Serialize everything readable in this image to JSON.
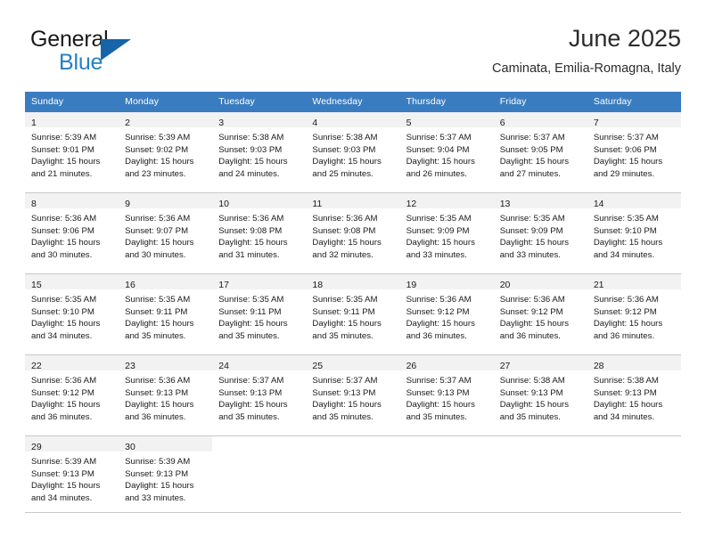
{
  "brand": {
    "word1": "General",
    "word2": "Blue",
    "triangle_color": "#1565a8",
    "blue_color": "#2481c4"
  },
  "header": {
    "title": "June 2025",
    "subtitle": "Caminata, Emilia-Romagna, Italy",
    "header_bg": "#3a7cc0"
  },
  "weekdays": [
    "Sunday",
    "Monday",
    "Tuesday",
    "Wednesday",
    "Thursday",
    "Friday",
    "Saturday"
  ],
  "weeks": [
    [
      {
        "day": "1",
        "sunrise": "Sunrise: 5:39 AM",
        "sunset": "Sunset: 9:01 PM",
        "daylight1": "Daylight: 15 hours",
        "daylight2": "and 21 minutes."
      },
      {
        "day": "2",
        "sunrise": "Sunrise: 5:39 AM",
        "sunset": "Sunset: 9:02 PM",
        "daylight1": "Daylight: 15 hours",
        "daylight2": "and 23 minutes."
      },
      {
        "day": "3",
        "sunrise": "Sunrise: 5:38 AM",
        "sunset": "Sunset: 9:03 PM",
        "daylight1": "Daylight: 15 hours",
        "daylight2": "and 24 minutes."
      },
      {
        "day": "4",
        "sunrise": "Sunrise: 5:38 AM",
        "sunset": "Sunset: 9:03 PM",
        "daylight1": "Daylight: 15 hours",
        "daylight2": "and 25 minutes."
      },
      {
        "day": "5",
        "sunrise": "Sunrise: 5:37 AM",
        "sunset": "Sunset: 9:04 PM",
        "daylight1": "Daylight: 15 hours",
        "daylight2": "and 26 minutes."
      },
      {
        "day": "6",
        "sunrise": "Sunrise: 5:37 AM",
        "sunset": "Sunset: 9:05 PM",
        "daylight1": "Daylight: 15 hours",
        "daylight2": "and 27 minutes."
      },
      {
        "day": "7",
        "sunrise": "Sunrise: 5:37 AM",
        "sunset": "Sunset: 9:06 PM",
        "daylight1": "Daylight: 15 hours",
        "daylight2": "and 29 minutes."
      }
    ],
    [
      {
        "day": "8",
        "sunrise": "Sunrise: 5:36 AM",
        "sunset": "Sunset: 9:06 PM",
        "daylight1": "Daylight: 15 hours",
        "daylight2": "and 30 minutes."
      },
      {
        "day": "9",
        "sunrise": "Sunrise: 5:36 AM",
        "sunset": "Sunset: 9:07 PM",
        "daylight1": "Daylight: 15 hours",
        "daylight2": "and 30 minutes."
      },
      {
        "day": "10",
        "sunrise": "Sunrise: 5:36 AM",
        "sunset": "Sunset: 9:08 PM",
        "daylight1": "Daylight: 15 hours",
        "daylight2": "and 31 minutes."
      },
      {
        "day": "11",
        "sunrise": "Sunrise: 5:36 AM",
        "sunset": "Sunset: 9:08 PM",
        "daylight1": "Daylight: 15 hours",
        "daylight2": "and 32 minutes."
      },
      {
        "day": "12",
        "sunrise": "Sunrise: 5:35 AM",
        "sunset": "Sunset: 9:09 PM",
        "daylight1": "Daylight: 15 hours",
        "daylight2": "and 33 minutes."
      },
      {
        "day": "13",
        "sunrise": "Sunrise: 5:35 AM",
        "sunset": "Sunset: 9:09 PM",
        "daylight1": "Daylight: 15 hours",
        "daylight2": "and 33 minutes."
      },
      {
        "day": "14",
        "sunrise": "Sunrise: 5:35 AM",
        "sunset": "Sunset: 9:10 PM",
        "daylight1": "Daylight: 15 hours",
        "daylight2": "and 34 minutes."
      }
    ],
    [
      {
        "day": "15",
        "sunrise": "Sunrise: 5:35 AM",
        "sunset": "Sunset: 9:10 PM",
        "daylight1": "Daylight: 15 hours",
        "daylight2": "and 34 minutes."
      },
      {
        "day": "16",
        "sunrise": "Sunrise: 5:35 AM",
        "sunset": "Sunset: 9:11 PM",
        "daylight1": "Daylight: 15 hours",
        "daylight2": "and 35 minutes."
      },
      {
        "day": "17",
        "sunrise": "Sunrise: 5:35 AM",
        "sunset": "Sunset: 9:11 PM",
        "daylight1": "Daylight: 15 hours",
        "daylight2": "and 35 minutes."
      },
      {
        "day": "18",
        "sunrise": "Sunrise: 5:35 AM",
        "sunset": "Sunset: 9:11 PM",
        "daylight1": "Daylight: 15 hours",
        "daylight2": "and 35 minutes."
      },
      {
        "day": "19",
        "sunrise": "Sunrise: 5:36 AM",
        "sunset": "Sunset: 9:12 PM",
        "daylight1": "Daylight: 15 hours",
        "daylight2": "and 36 minutes."
      },
      {
        "day": "20",
        "sunrise": "Sunrise: 5:36 AM",
        "sunset": "Sunset: 9:12 PM",
        "daylight1": "Daylight: 15 hours",
        "daylight2": "and 36 minutes."
      },
      {
        "day": "21",
        "sunrise": "Sunrise: 5:36 AM",
        "sunset": "Sunset: 9:12 PM",
        "daylight1": "Daylight: 15 hours",
        "daylight2": "and 36 minutes."
      }
    ],
    [
      {
        "day": "22",
        "sunrise": "Sunrise: 5:36 AM",
        "sunset": "Sunset: 9:12 PM",
        "daylight1": "Daylight: 15 hours",
        "daylight2": "and 36 minutes."
      },
      {
        "day": "23",
        "sunrise": "Sunrise: 5:36 AM",
        "sunset": "Sunset: 9:13 PM",
        "daylight1": "Daylight: 15 hours",
        "daylight2": "and 36 minutes."
      },
      {
        "day": "24",
        "sunrise": "Sunrise: 5:37 AM",
        "sunset": "Sunset: 9:13 PM",
        "daylight1": "Daylight: 15 hours",
        "daylight2": "and 35 minutes."
      },
      {
        "day": "25",
        "sunrise": "Sunrise: 5:37 AM",
        "sunset": "Sunset: 9:13 PM",
        "daylight1": "Daylight: 15 hours",
        "daylight2": "and 35 minutes."
      },
      {
        "day": "26",
        "sunrise": "Sunrise: 5:37 AM",
        "sunset": "Sunset: 9:13 PM",
        "daylight1": "Daylight: 15 hours",
        "daylight2": "and 35 minutes."
      },
      {
        "day": "27",
        "sunrise": "Sunrise: 5:38 AM",
        "sunset": "Sunset: 9:13 PM",
        "daylight1": "Daylight: 15 hours",
        "daylight2": "and 35 minutes."
      },
      {
        "day": "28",
        "sunrise": "Sunrise: 5:38 AM",
        "sunset": "Sunset: 9:13 PM",
        "daylight1": "Daylight: 15 hours",
        "daylight2": "and 34 minutes."
      }
    ],
    [
      {
        "day": "29",
        "sunrise": "Sunrise: 5:39 AM",
        "sunset": "Sunset: 9:13 PM",
        "daylight1": "Daylight: 15 hours",
        "daylight2": "and 34 minutes."
      },
      {
        "day": "30",
        "sunrise": "Sunrise: 5:39 AM",
        "sunset": "Sunset: 9:13 PM",
        "daylight1": "Daylight: 15 hours",
        "daylight2": "and 33 minutes."
      },
      {
        "day": "",
        "sunrise": "",
        "sunset": "",
        "daylight1": "",
        "daylight2": ""
      },
      {
        "day": "",
        "sunrise": "",
        "sunset": "",
        "daylight1": "",
        "daylight2": ""
      },
      {
        "day": "",
        "sunrise": "",
        "sunset": "",
        "daylight1": "",
        "daylight2": ""
      },
      {
        "day": "",
        "sunrise": "",
        "sunset": "",
        "daylight1": "",
        "daylight2": ""
      },
      {
        "day": "",
        "sunrise": "",
        "sunset": "",
        "daylight1": "",
        "daylight2": ""
      }
    ]
  ]
}
